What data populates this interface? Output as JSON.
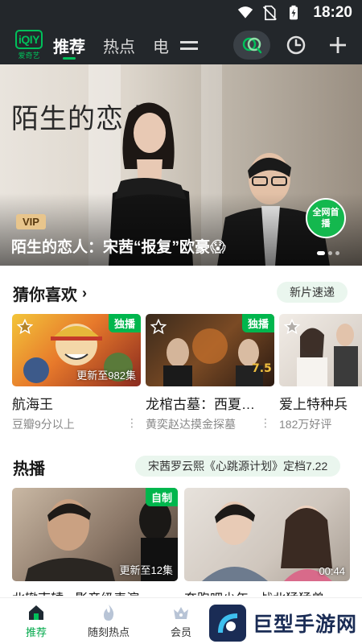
{
  "status_bar": {
    "time": "18:20",
    "icons": [
      "wifi-icon",
      "no-sim-icon",
      "battery-charging-icon"
    ]
  },
  "app": {
    "logo_text": "iQIY",
    "logo_sub": "爱奇艺"
  },
  "top_tabs": [
    {
      "label": "推荐",
      "active": true
    },
    {
      "label": "热点",
      "active": false
    },
    {
      "label": "电",
      "active": false
    }
  ],
  "banner": {
    "poster_title": "陌生的恋人",
    "vip_label": "VIP",
    "caption": "陌生的恋人：宋茜“报复”欧豪😱",
    "badge": "全网首播",
    "badge_brand": "iQIY"
  },
  "guess_section": {
    "title": "猜你喜欢",
    "chevron": "›",
    "pill": "新片速递",
    "cards": [
      {
        "title": "航海王",
        "subtitle": "豆瓣9分以上",
        "corner": "独播",
        "note": "更新至982集",
        "more": "⋮"
      },
      {
        "title": "龙棺古墓：西夏…",
        "subtitle": "黄奕赵达摸金探墓",
        "corner": "独播",
        "note": "",
        "more": "⋮"
      },
      {
        "title": "爱上特种兵",
        "subtitle": "182万好评",
        "corner": "",
        "note": "",
        "more": ""
      }
    ]
  },
  "hot_section": {
    "title": "热播",
    "pill": "宋茜罗云熙《心跳源计划》定档7.22",
    "cards": [
      {
        "corner": "自制",
        "note": "更新至12集",
        "title": "北辙南辕 · 影帝级表演"
      },
      {
        "corner": "",
        "note": "00:44",
        "title": "奔跑吧少年 · 战北猛猛兽"
      }
    ]
  },
  "bottom_nav": [
    {
      "label": "推荐",
      "icon": "home-icon",
      "active": true
    },
    {
      "label": "随刻热点",
      "icon": "flame-icon",
      "active": false
    },
    {
      "label": "会员",
      "icon": "crown-icon",
      "active": false
    }
  ],
  "watermark": {
    "text": "巨型手游网"
  },
  "colors": {
    "brand_green": "#00C05A",
    "topbar": "#23272B",
    "pill_bg": "#EAF6EE",
    "vip_gold": "#E8C58C"
  }
}
